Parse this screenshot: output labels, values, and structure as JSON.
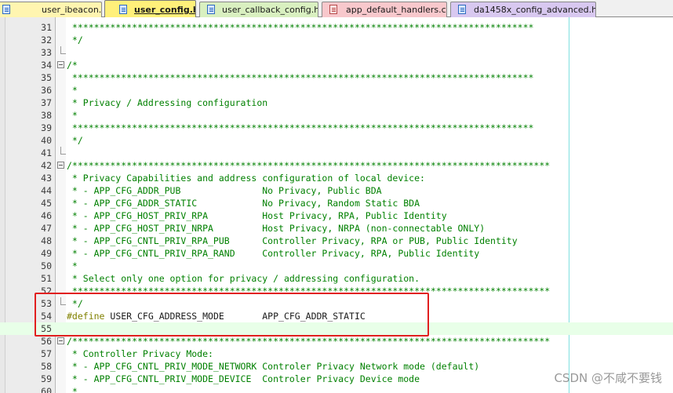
{
  "tabs": [
    {
      "label": "user_ibeacon.c",
      "color": "#fff5b0",
      "state": "saved"
    },
    {
      "label": "user_config.h",
      "color": "#fff07a",
      "state": "active"
    },
    {
      "label": "user_callback_config.h",
      "color": "#d9f0c0",
      "state": "saved"
    },
    {
      "label": "app_default_handlers.c",
      "color": "#f8c8cc",
      "state": "modified"
    },
    {
      "label": "da1458x_config_advanced.h",
      "color": "#d8c8f0",
      "state": "saved"
    }
  ],
  "lines": [
    {
      "num": "31",
      "text": " *************************************************************************************",
      "kind": "comment",
      "fold": "line"
    },
    {
      "num": "32",
      "text": " */",
      "kind": "comment",
      "fold": "line"
    },
    {
      "num": "33",
      "text": "",
      "kind": "plain",
      "fold": "end"
    },
    {
      "num": "34",
      "text": "/*",
      "kind": "comment",
      "fold": "start"
    },
    {
      "num": "35",
      "text": " *************************************************************************************",
      "kind": "comment",
      "fold": "line"
    },
    {
      "num": "36",
      "text": " *",
      "kind": "comment",
      "fold": "line"
    },
    {
      "num": "37",
      "text": " * Privacy / Addressing configuration",
      "kind": "comment",
      "fold": "line"
    },
    {
      "num": "38",
      "text": " *",
      "kind": "comment",
      "fold": "line"
    },
    {
      "num": "39",
      "text": " *************************************************************************************",
      "kind": "comment",
      "fold": "line"
    },
    {
      "num": "40",
      "text": " */",
      "kind": "comment",
      "fold": "line"
    },
    {
      "num": "41",
      "text": "",
      "kind": "plain",
      "fold": "end"
    },
    {
      "num": "42",
      "text": "/****************************************************************************************",
      "kind": "comment",
      "fold": "start"
    },
    {
      "num": "43",
      "text": " * Privacy Capabilities and address configuration of local device:",
      "kind": "comment",
      "fold": "line"
    },
    {
      "num": "44",
      "text": " * - APP_CFG_ADDR_PUB               No Privacy, Public BDA",
      "kind": "comment",
      "fold": "line"
    },
    {
      "num": "45",
      "text": " * - APP_CFG_ADDR_STATIC            No Privacy, Random Static BDA",
      "kind": "comment",
      "fold": "line"
    },
    {
      "num": "46",
      "text": " * - APP_CFG_HOST_PRIV_RPA          Host Privacy, RPA, Public Identity",
      "kind": "comment",
      "fold": "line"
    },
    {
      "num": "47",
      "text": " * - APP_CFG_HOST_PRIV_NRPA         Host Privacy, NRPA (non-connectable ONLY)",
      "kind": "comment",
      "fold": "line"
    },
    {
      "num": "48",
      "text": " * - APP_CFG_CNTL_PRIV_RPA_PUB      Controller Privacy, RPA or PUB, Public Identity",
      "kind": "comment",
      "fold": "line"
    },
    {
      "num": "49",
      "text": " * - APP_CFG_CNTL_PRIV_RPA_RAND     Controller Privacy, RPA, Public Identity",
      "kind": "comment",
      "fold": "line"
    },
    {
      "num": "50",
      "text": " *",
      "kind": "comment",
      "fold": "line"
    },
    {
      "num": "51",
      "text": " * Select only one option for privacy / addressing configuration.",
      "kind": "comment",
      "fold": "line"
    },
    {
      "num": "52",
      "text": " ****************************************************************************************",
      "kind": "comment",
      "fold": "line"
    },
    {
      "num": "53",
      "text": " */",
      "kind": "comment",
      "fold": "end"
    },
    {
      "num": "54",
      "directive": "#define",
      "macro": " USER_CFG_ADDRESS_MODE",
      "value": "       APP_CFG_ADDR_STATIC",
      "kind": "define",
      "fold": "none"
    },
    {
      "num": "55",
      "text": "",
      "kind": "plain",
      "fold": "none",
      "current": true
    },
    {
      "num": "56",
      "text": "/****************************************************************************************",
      "kind": "comment",
      "fold": "start"
    },
    {
      "num": "57",
      "text": " * Controller Privacy Mode:",
      "kind": "comment",
      "fold": "line"
    },
    {
      "num": "58",
      "text": " * - APP_CFG_CNTL_PRIV_MODE_NETWORK Controler Privacy Network mode (default)",
      "kind": "comment",
      "fold": "line"
    },
    {
      "num": "59",
      "text": " * - APP_CFG_CNTL_PRIV_MODE_DEVICE  Controler Privacy Device mode",
      "kind": "comment",
      "fold": "line"
    },
    {
      "num": "60",
      "text": " *",
      "kind": "comment",
      "fold": "line"
    }
  ],
  "watermark": "CSDN @不咸不要钱",
  "colors": {
    "comment": "#008000",
    "directive": "#808000",
    "highlight_box": "#e11f1f",
    "current_line": "#e8ffe8",
    "edge_line": "#7fe0e0"
  }
}
